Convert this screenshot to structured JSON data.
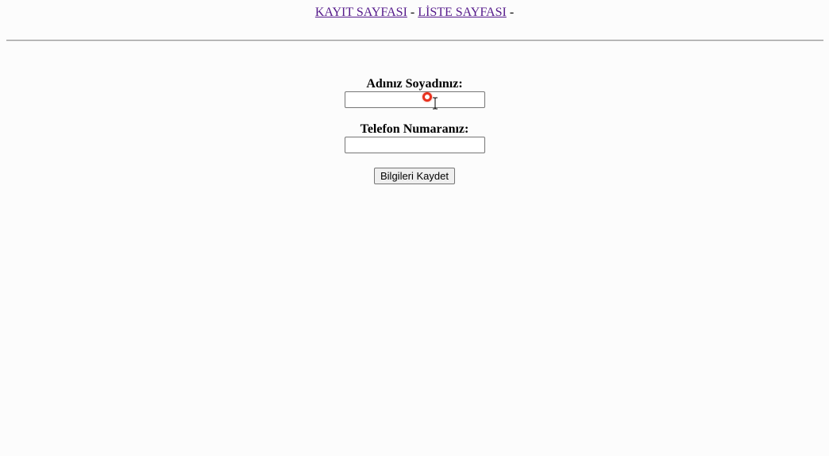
{
  "nav": {
    "link_register": "KAYIT SAYFASI",
    "separator_1": "-",
    "link_list": "LİSTE SAYFASI",
    "separator_2": "-"
  },
  "form": {
    "name_label": "Adınız Soyadınız:",
    "name_value": "",
    "phone_label": "Telefon Numaranız:",
    "phone_value": "",
    "submit_label": "Bilgileri Kaydet"
  },
  "colors": {
    "visited_link": "#551a8b",
    "cursor_highlight": "#e8321f",
    "background": "#fcfcfc"
  },
  "icons": {
    "pointer": "text-cursor-icon",
    "click_marker": "click-highlight-icon"
  }
}
